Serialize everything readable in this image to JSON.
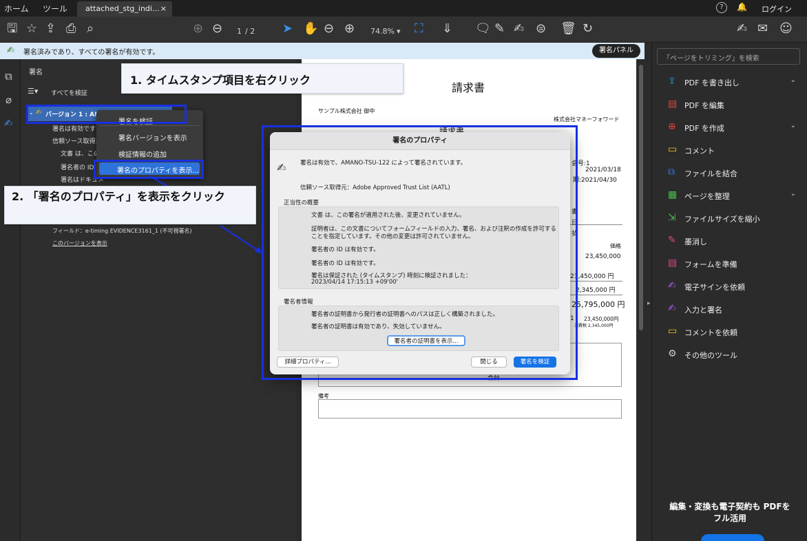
{
  "tabbar": {
    "home": "ホーム",
    "tools": "ツール",
    "doc_tab": "attached_stg_indi...",
    "close": "×",
    "help": "?",
    "bell": "🔔",
    "login": "ログイン"
  },
  "toolbar": {
    "page_current": "1",
    "page_total": "/ 2",
    "zoom": "74.8%",
    "zoom_caret": "▾"
  },
  "sigbar": {
    "message": "署名済みであり、すべての署名が有効です。",
    "panel_button": "署名パネル"
  },
  "sigpanel": {
    "title": "署名",
    "verify_all": "すべてを検証",
    "version": "バージョン 1 : AMAN",
    "rows": [
      "署名は有効です：",
      "信頼ソース取得元：",
      "文書 は、この",
      "署名者の ID",
      "署名はドキュメ"
    ],
    "field": "フィールド：e-timing EVIDENCE3161_1 (不可視署名)",
    "show_version": "このバージョンを表示"
  },
  "context_menu": {
    "items": [
      "署名を検証",
      "署名バージョンを表示",
      "検証情報の追加",
      "署名のプロパティを表示..."
    ]
  },
  "callouts": {
    "step1": "1. タイムスタンプ項目を右クリック",
    "step2": "2. 「署名のプロパティ」を表示をクリック"
  },
  "invoice": {
    "title": "請求書",
    "to": "サンプル株式会社 御中",
    "from": "株式会社マネーフォワード",
    "no": "会号:1",
    "date1": "2021/03/18",
    "date2": "期:2021/04/30",
    "price_header": "価格",
    "rows": [
      "23,450,000",
      "23,450,000 円",
      "2,345,000 円",
      "25,795,000 円"
    ],
    "small1": "23,450,000円",
    "small2": "消費税 2,345,000円",
    "note_label": "備考",
    "partial_total": "合計",
    "cut_heading": "請求書",
    "cut_r1": "書",
    "cut_r2": "日",
    "cut_r3": "払",
    "cut_one": "1",
    "cut_arrow": "▸"
  },
  "dialog": {
    "title": "署名のプロパティ",
    "status": "署名は有効で、AMANO-TSU-122 によって署名されています。",
    "trust_source": "信頼ソース取得元：Adobe Approved Trust List (AATL)",
    "validity_heading": "正当性の概要",
    "validity": [
      "文書 は、この署名が適用された後、変更されていません。",
      "証明者は、この文書についてフォームフィールドの入力、署名、および注釈の作成を許可する",
      "ことを指定しています。その他の変更は許可されていません。",
      "署名者の ID は有効です。",
      "署名者の ID は有効です。",
      "署名は保証された (タイムスタンプ) 時刻に検証されました：",
      "2023/04/14 17:15:13 +09'00'"
    ],
    "signer_heading": "署名者情報",
    "signer": [
      "署名者の証明書から発行者の証明書へのパスは正しく構築されました。",
      "署名者の証明書は有効であり、失効していません。"
    ],
    "show_cert": "署名者の証明書を表示...",
    "advanced": "詳細プロパティ...",
    "close": "閉じる",
    "verify": "署名を検証"
  },
  "rightpanel": {
    "search_placeholder": "「ページをトリミング」を検索",
    "tools": [
      {
        "label": "PDF を書き出し",
        "icon": "export-pdf-icon",
        "color": "#19a0c8"
      },
      {
        "label": "PDF を編集",
        "icon": "edit-pdf-icon",
        "color": "#e8423c"
      },
      {
        "label": "PDF を作成",
        "icon": "create-pdf-icon",
        "color": "#e8423c"
      },
      {
        "label": "コメント",
        "icon": "comment-icon",
        "color": "#f5c518"
      },
      {
        "label": "ファイルを結合",
        "icon": "combine-files-icon",
        "color": "#2d7be0"
      },
      {
        "label": "ページを整理",
        "icon": "organize-pages-icon",
        "color": "#4cbf4c"
      },
      {
        "label": "ファイルサイズを縮小",
        "icon": "compress-icon",
        "color": "#4cbf4c"
      },
      {
        "label": "墨消し",
        "icon": "redact-icon",
        "color": "#e0438c"
      },
      {
        "label": "フォームを準備",
        "icon": "prepare-form-icon",
        "color": "#e0438c"
      },
      {
        "label": "電子サインを依頼",
        "icon": "request-esign-icon",
        "color": "#a45ce0"
      },
      {
        "label": "入力と署名",
        "icon": "fill-sign-icon",
        "color": "#a45ce0"
      },
      {
        "label": "コメントを依頼",
        "icon": "request-comment-icon",
        "color": "#f5c518"
      },
      {
        "label": "その他のツール",
        "icon": "more-tools-icon",
        "color": "#cccccc"
      }
    ],
    "promo": "編集・変換も電子契約も PDFをフル活用"
  },
  "colors": {
    "accent": "#1473e6",
    "annotation_blue": "#1730e0",
    "selection": "#2d73d9"
  }
}
